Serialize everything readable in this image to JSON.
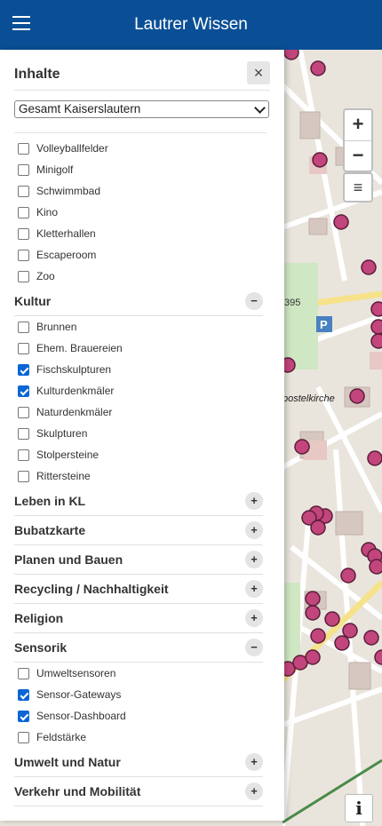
{
  "header": {
    "title": "Lautrer Wissen"
  },
  "panel": {
    "title": "Inhalte",
    "close_label": "×",
    "region_selected": "Gesamt Kaiserslautern",
    "top_items": [
      {
        "label": "Volleyballfelder",
        "checked": false
      },
      {
        "label": "Minigolf",
        "checked": false
      },
      {
        "label": "Schwimmbad",
        "checked": false
      },
      {
        "label": "Kino",
        "checked": false
      },
      {
        "label": "Kletterhallen",
        "checked": false
      },
      {
        "label": "Escaperoom",
        "checked": false
      },
      {
        "label": "Zoo",
        "checked": false
      }
    ],
    "categories": [
      {
        "label": "Kultur",
        "toggle": "−",
        "items": [
          {
            "label": "Brunnen",
            "checked": false
          },
          {
            "label": "Ehem. Brauereien",
            "checked": false
          },
          {
            "label": "Fischskulpturen",
            "checked": true
          },
          {
            "label": "Kulturdenkmäler",
            "checked": true
          },
          {
            "label": "Naturdenkmäler",
            "checked": false
          },
          {
            "label": "Skulpturen",
            "checked": false
          },
          {
            "label": "Stolpersteine",
            "checked": false
          },
          {
            "label": "Rittersteine",
            "checked": false
          }
        ]
      },
      {
        "label": "Leben in KL",
        "toggle": "+",
        "items": []
      },
      {
        "label": "Bubatzkarte",
        "toggle": "+",
        "items": []
      },
      {
        "label": "Planen und Bauen",
        "toggle": "+",
        "items": []
      },
      {
        "label": "Recycling / Nachhaltigkeit",
        "toggle": "+",
        "items": []
      },
      {
        "label": "Religion",
        "toggle": "+",
        "items": []
      },
      {
        "label": "Sensorik",
        "toggle": "−",
        "items": [
          {
            "label": "Umweltsensoren",
            "checked": false
          },
          {
            "label": "Sensor-Gateways",
            "checked": true
          },
          {
            "label": "Sensor-Dashboard",
            "checked": true
          },
          {
            "label": "Feldstärke",
            "checked": false
          }
        ]
      },
      {
        "label": "Umwelt und Natur",
        "toggle": "+",
        "items": []
      },
      {
        "label": "Verkehr und Mobilität",
        "toggle": "+",
        "items": []
      }
    ]
  },
  "map": {
    "zoom_in": "+",
    "zoom_out": "−",
    "layers_icon": "≡",
    "info_label": "i",
    "labels": {
      "road": "395",
      "parking": "P",
      "church": "postelkirche"
    },
    "marker_color": "#c2457c"
  }
}
